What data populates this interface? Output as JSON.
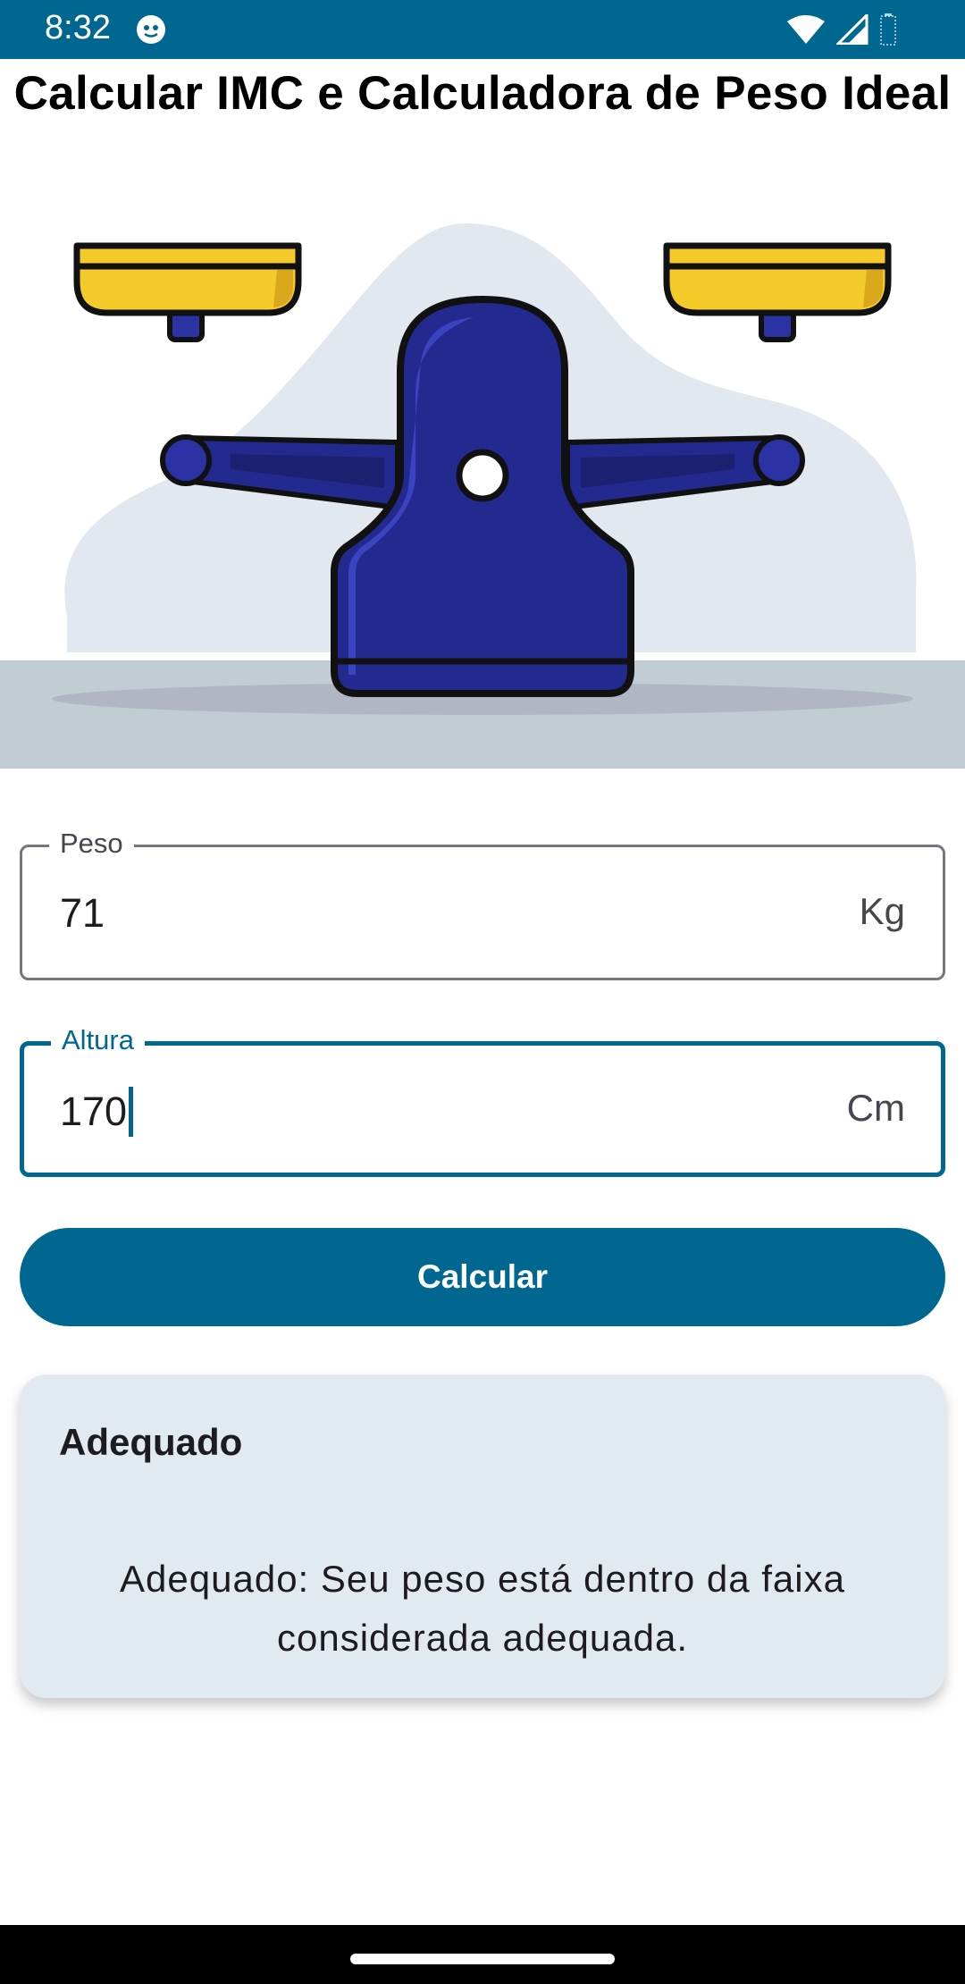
{
  "status_bar": {
    "time": "8:32",
    "icons": [
      "app-notification-icon",
      "wifi-icon",
      "signal-icon",
      "battery-icon"
    ],
    "background": "#006890"
  },
  "page": {
    "title": "Calcular IMC e Calculadora de Peso Ideal"
  },
  "illustration": {
    "subject": "balance-scale-icon",
    "colors": {
      "pans": "#f4cb2a",
      "body": "#232a8f",
      "blob": "#e1e8ef",
      "floor": "#c2ccd3"
    }
  },
  "form": {
    "weight": {
      "label": "Peso",
      "value": "71",
      "suffix": "Kg"
    },
    "height": {
      "label": "Altura",
      "value": "170",
      "suffix": "Cm"
    },
    "submit_label": "Calcular"
  },
  "result": {
    "title": "Adequado",
    "message": "Adequado: Seu peso está dentro da faixa considerada adequada."
  },
  "theme": {
    "primary": "#006890",
    "card": "#e1eaf1"
  }
}
